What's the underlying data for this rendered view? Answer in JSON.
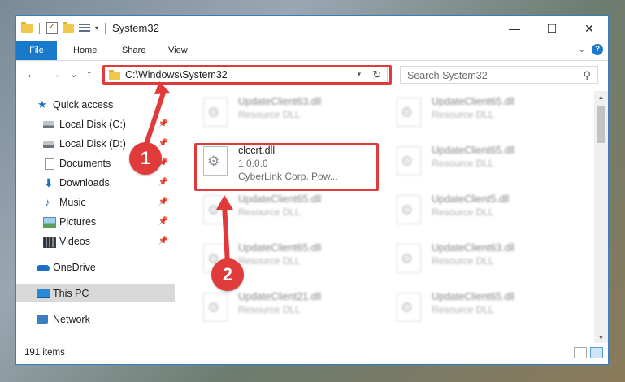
{
  "window": {
    "title": "System32",
    "controls": {
      "minimize": "—",
      "maximize": "☐",
      "close": "✕"
    }
  },
  "ribbon": {
    "tabs": [
      "File",
      "Home",
      "Share",
      "View"
    ],
    "help": "?"
  },
  "nav_buttons": {
    "back": "←",
    "forward": "→",
    "recent": "⌄",
    "up": "↑"
  },
  "address": {
    "path": "C:\\Windows\\System32",
    "refresh": "↻"
  },
  "search": {
    "placeholder": "Search System32"
  },
  "nav_pane": {
    "items": [
      {
        "label": "Quick access",
        "icon": "star-icon",
        "pinned": false
      },
      {
        "label": "Local Disk (C:)",
        "icon": "drive-icon",
        "pinned": true
      },
      {
        "label": "Local Disk (D:)",
        "icon": "drive-icon",
        "pinned": true
      },
      {
        "label": "Documents",
        "icon": "documents-icon",
        "pinned": true
      },
      {
        "label": "Downloads",
        "icon": "downloads-icon",
        "pinned": true
      },
      {
        "label": "Music",
        "icon": "music-icon",
        "pinned": true
      },
      {
        "label": "Pictures",
        "icon": "pictures-icon",
        "pinned": true
      },
      {
        "label": "Videos",
        "icon": "videos-icon",
        "pinned": true
      },
      {
        "label": "OneDrive",
        "icon": "onedrive-icon",
        "pinned": false
      },
      {
        "label": "This PC",
        "icon": "this-pc-icon",
        "pinned": false,
        "selected": true
      },
      {
        "label": "Network",
        "icon": "network-icon",
        "pinned": false
      }
    ]
  },
  "files": [
    {
      "name": "UpdateClient63.dll",
      "type": "Resource DLL"
    },
    {
      "name": "UpdateClient65.dll",
      "type": "Resource DLL"
    },
    {
      "name": "clccrt.dll",
      "version": "1.0.0.0",
      "company": "CyberLink Corp. Pow...",
      "highlighted": true
    },
    {
      "name": "UpdateClient65.dll",
      "type": "Resource DLL"
    },
    {
      "name": "UpdateClient65.dll",
      "type": "Resource DLL"
    },
    {
      "name": "UpdateClient5.dll",
      "type": "Resource DLL"
    },
    {
      "name": "UpdateClient65.dll",
      "type": "Resource DLL"
    },
    {
      "name": "UpdateClient63.dll",
      "type": "Resource DLL"
    },
    {
      "name": "UpdateClient21.dll",
      "type": "Resource DLL"
    },
    {
      "name": "UpdateClient65.dll",
      "type": "Resource DLL"
    }
  ],
  "status": {
    "item_count": "191 items"
  },
  "annotations": {
    "marker1": "1",
    "marker2": "2",
    "color": "#e03a3a"
  }
}
